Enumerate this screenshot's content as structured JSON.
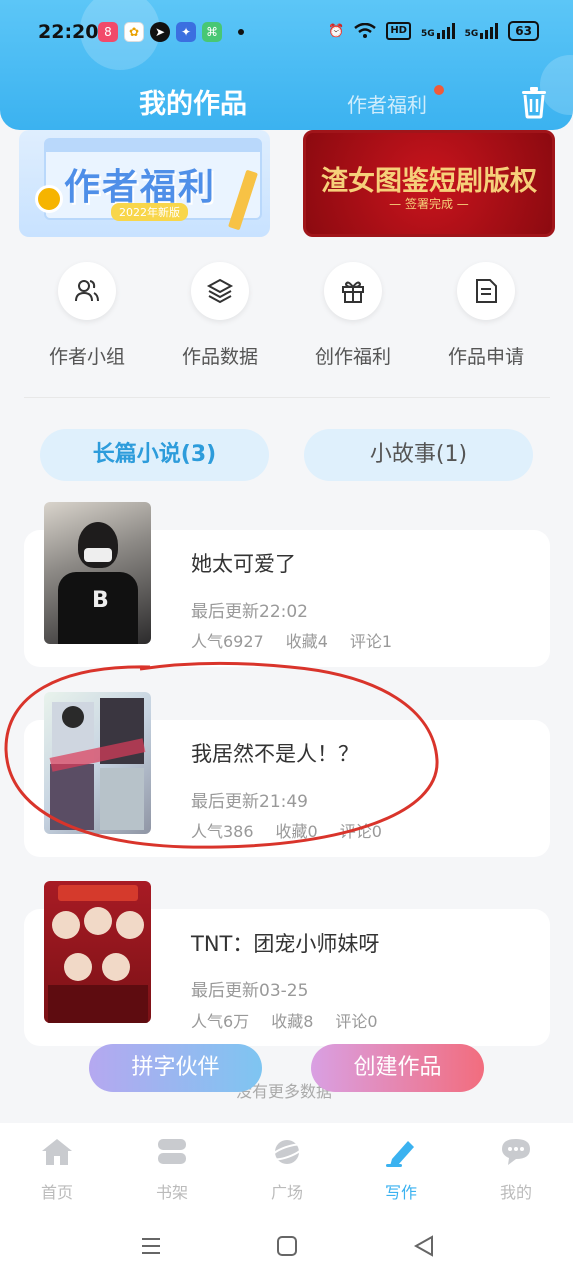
{
  "status": {
    "time": "22:20",
    "hd": "HD",
    "net1": "5G",
    "net2": "5G",
    "battery": "63"
  },
  "header": {
    "title": "我的作品",
    "tab2": "作者福利"
  },
  "banners": {
    "left_title": "作者福利",
    "left_sub": "2022年新版",
    "right_title": "渣女图鉴短剧版权",
    "right_sub": "— 签署完成 —"
  },
  "quick_actions": [
    {
      "label": "作者小组",
      "icon": "users-icon"
    },
    {
      "label": "作品数据",
      "icon": "layers-icon"
    },
    {
      "label": "创作福利",
      "icon": "gift-icon"
    },
    {
      "label": "作品申请",
      "icon": "document-icon"
    }
  ],
  "tabs": [
    {
      "label": "长篇小说(3)",
      "active": true
    },
    {
      "label": "小故事(1)",
      "active": false
    }
  ],
  "works": [
    {
      "title": "她太可爱了",
      "updated": "最后更新22:02",
      "popularity": "人气6927",
      "favorites": "收藏4",
      "comments": "评论1"
    },
    {
      "title": "我居然不是人！？",
      "updated": "最后更新21:49",
      "popularity": "人气386",
      "favorites": "收藏0",
      "comments": "评论0"
    },
    {
      "title": "TNT：团宠小师妹呀",
      "updated": "最后更新03-25",
      "popularity": "人气6万",
      "favorites": "收藏8",
      "comments": "评论0"
    }
  ],
  "buttons": {
    "partner": "拼字伙伴",
    "create": "创建作品"
  },
  "footer_hint": "没有更多数据",
  "nav": [
    {
      "label": "首页",
      "icon": "home-icon",
      "active": false
    },
    {
      "label": "书架",
      "icon": "bookshelf-icon",
      "active": false
    },
    {
      "label": "广场",
      "icon": "planet-icon",
      "active": false
    },
    {
      "label": "写作",
      "icon": "pen-icon",
      "active": true
    },
    {
      "label": "我的",
      "icon": "chat-icon",
      "active": false
    }
  ],
  "colors": {
    "accent": "#3bb2f0",
    "annotation": "#d9342b"
  }
}
